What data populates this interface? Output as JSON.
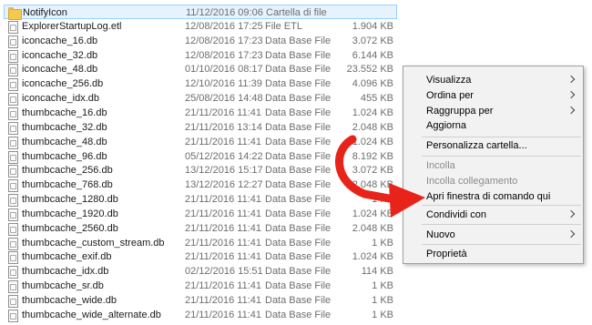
{
  "files": [
    {
      "name": "NotifyIcon",
      "date": "11/12/2016 09:06",
      "type": "Cartella di file",
      "size": "",
      "icon": "folder-icon"
    },
    {
      "name": "ExplorerStartupLog.etl",
      "date": "12/08/2016 17:25",
      "type": "File ETL",
      "size": "1.904 KB",
      "icon": "file-icon"
    },
    {
      "name": "iconcache_16.db",
      "date": "12/08/2016 17:23",
      "type": "Data Base File",
      "size": "3.072 KB",
      "icon": "file-icon"
    },
    {
      "name": "iconcache_32.db",
      "date": "12/08/2016 17:23",
      "type": "Data Base File",
      "size": "6.144 KB",
      "icon": "file-icon"
    },
    {
      "name": "iconcache_48.db",
      "date": "01/10/2016 08:17",
      "type": "Data Base File",
      "size": "23.552 KB",
      "icon": "file-icon"
    },
    {
      "name": "iconcache_256.db",
      "date": "12/10/2016 11:39",
      "type": "Data Base File",
      "size": "4.096 KB",
      "icon": "file-icon"
    },
    {
      "name": "iconcache_idx.db",
      "date": "25/08/2016 14:48",
      "type": "Data Base File",
      "size": "455 KB",
      "icon": "file-icon"
    },
    {
      "name": "thumbcache_16.db",
      "date": "21/11/2016 11:41",
      "type": "Data Base File",
      "size": "1.024 KB",
      "icon": "file-icon"
    },
    {
      "name": "thumbcache_32.db",
      "date": "21/11/2016 13:14",
      "type": "Data Base File",
      "size": "2.048 KB",
      "icon": "file-icon"
    },
    {
      "name": "thumbcache_48.db",
      "date": "21/11/2016 11:41",
      "type": "Data Base File",
      "size": "1.024 KB",
      "icon": "file-icon"
    },
    {
      "name": "thumbcache_96.db",
      "date": "05/12/2016 14:22",
      "type": "Data Base File",
      "size": "8.192 KB",
      "icon": "file-icon"
    },
    {
      "name": "thumbcache_256.db",
      "date": "13/12/2016 15:17",
      "type": "Data Base File",
      "size": "3.072 KB",
      "icon": "file-icon"
    },
    {
      "name": "thumbcache_768.db",
      "date": "13/12/2016 12:27",
      "type": "Data Base File",
      "size": "2.048 KB",
      "icon": "file-icon"
    },
    {
      "name": "thumbcache_1280.db",
      "date": "21/11/2016 11:41",
      "type": "Data Base File",
      "size": "1 KB",
      "icon": "file-icon"
    },
    {
      "name": "thumbcache_1920.db",
      "date": "21/11/2016 11:41",
      "type": "Data Base File",
      "size": "1.024 KB",
      "icon": "file-icon"
    },
    {
      "name": "thumbcache_2560.db",
      "date": "21/11/2016 11:41",
      "type": "Data Base File",
      "size": "2.048 KB",
      "icon": "file-icon"
    },
    {
      "name": "thumbcache_custom_stream.db",
      "date": "21/11/2016 11:41",
      "type": "Data Base File",
      "size": "1 KB",
      "icon": "file-icon"
    },
    {
      "name": "thumbcache_exif.db",
      "date": "21/11/2016 11:41",
      "type": "Data Base File",
      "size": "1.024 KB",
      "icon": "file-icon"
    },
    {
      "name": "thumbcache_idx.db",
      "date": "02/12/2016 15:51",
      "type": "Data Base File",
      "size": "114 KB",
      "icon": "file-icon"
    },
    {
      "name": "thumbcache_sr.db",
      "date": "21/11/2016 11:41",
      "type": "Data Base File",
      "size": "1 KB",
      "icon": "file-icon"
    },
    {
      "name": "thumbcache_wide.db",
      "date": "21/11/2016 11:41",
      "type": "Data Base File",
      "size": "1 KB",
      "icon": "file-icon"
    },
    {
      "name": "thumbcache_wide_alternate.db",
      "date": "21/11/2016 11:41",
      "type": "Data Base File",
      "size": "1 KB",
      "icon": "file-icon"
    }
  ],
  "context_menu": {
    "visualizza": "Visualizza",
    "ordina_per": "Ordina per",
    "raggruppa_per": "Raggruppa per",
    "aggiorna": "Aggiorna",
    "personalizza": "Personalizza cartella...",
    "incolla": "Incolla",
    "incolla_collegamento": "Incolla collegamento",
    "apri_finestra": "Apri finestra di comando qui",
    "condividi_con": "Condividi con",
    "nuovo": "Nuovo",
    "proprieta": "Proprietà"
  },
  "colors": {
    "annotation_arrow": "#e8241a",
    "selection": "#e5f3ff",
    "menu_bg": "#f2f2f2"
  }
}
